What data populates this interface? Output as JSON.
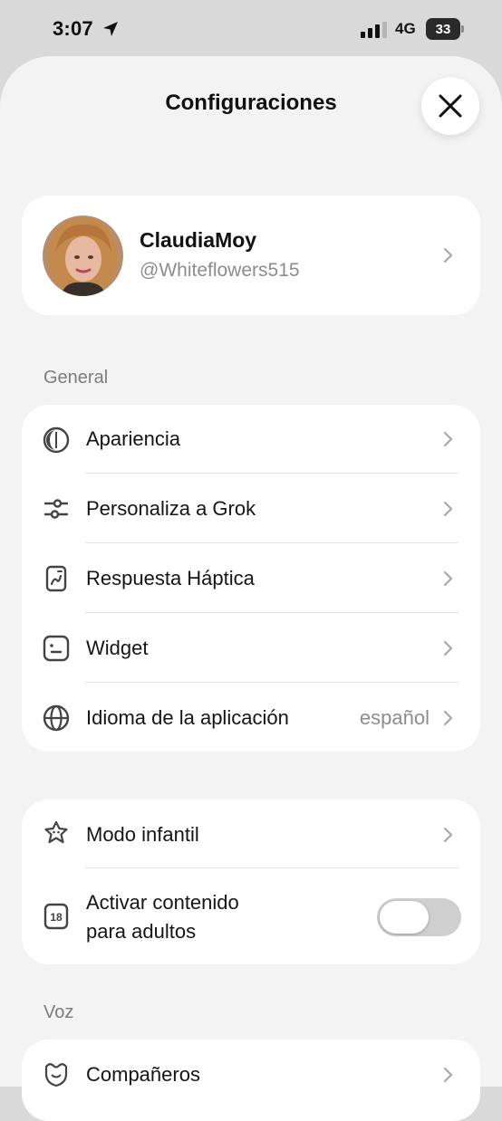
{
  "status_bar": {
    "time": "3:07",
    "network": "4G",
    "battery": "33"
  },
  "sheet": {
    "title": "Configuraciones"
  },
  "profile": {
    "name": "ClaudiaMoy",
    "handle": "@Whiteflowers515"
  },
  "sections": {
    "general": "General",
    "voice": "Voz"
  },
  "general_items": [
    {
      "label": "Apariencia",
      "icon": "appearance-icon"
    },
    {
      "label": "Personaliza a Grok",
      "icon": "sliders-icon"
    },
    {
      "label": "Respuesta Háptica",
      "icon": "haptic-icon"
    },
    {
      "label": "Widget",
      "icon": "widget-icon"
    },
    {
      "label": "Idioma de la aplicación",
      "value": "español",
      "icon": "globe-icon"
    }
  ],
  "kids_items": [
    {
      "label": "Modo infantil",
      "icon": "kid-mode-icon"
    },
    {
      "label_line1": "Activar contenido",
      "label_line2": "para adultos",
      "icon": "age-18-icon",
      "toggle_on": false
    }
  ],
  "voice_items": [
    {
      "label": "Compañeros",
      "icon": "companions-icon"
    }
  ],
  "colors": {
    "background": "#f3f3f3",
    "card": "#ffffff",
    "secondary_text": "#8d8d8d",
    "toggle_off": "#cfcfcf"
  }
}
